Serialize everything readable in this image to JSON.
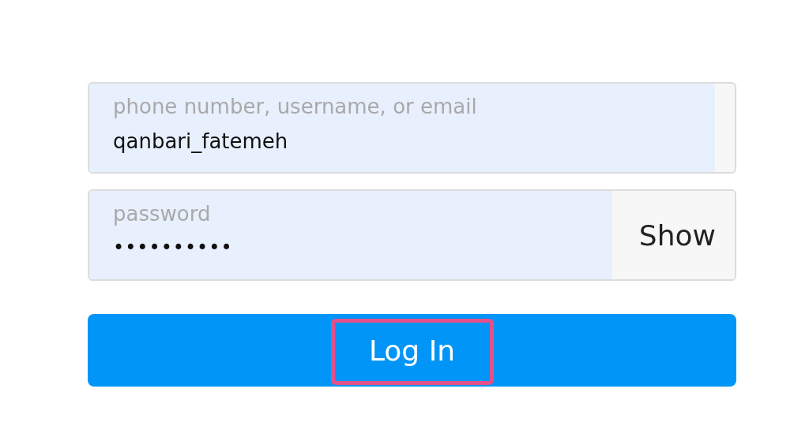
{
  "fields": [
    {
      "kind": "text",
      "label": "phone number, username, or email",
      "value": "qanbari_fatemeh"
    },
    {
      "kind": "password",
      "label": "password",
      "value": "••••••••••",
      "toggle": "Show"
    }
  ],
  "login_button": {
    "label": "Log In",
    "highlighted": true
  }
}
